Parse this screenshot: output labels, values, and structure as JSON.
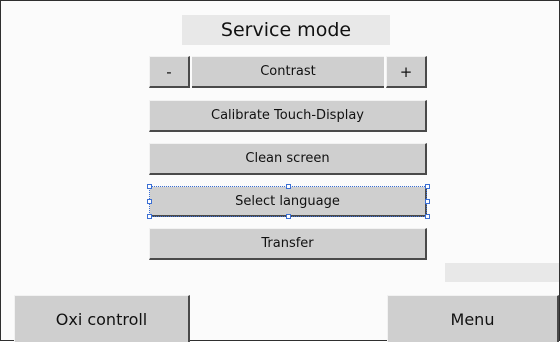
{
  "title": "Service mode",
  "contrast": {
    "decrease_label": "-",
    "label": "Contrast",
    "increase_label": "+"
  },
  "buttons": {
    "calibrate": "Calibrate Touch-Display",
    "clean": "Clean screen",
    "language": "Select language",
    "transfer": "Transfer"
  },
  "footer": {
    "left": "Oxi controll",
    "right": "Menu"
  }
}
